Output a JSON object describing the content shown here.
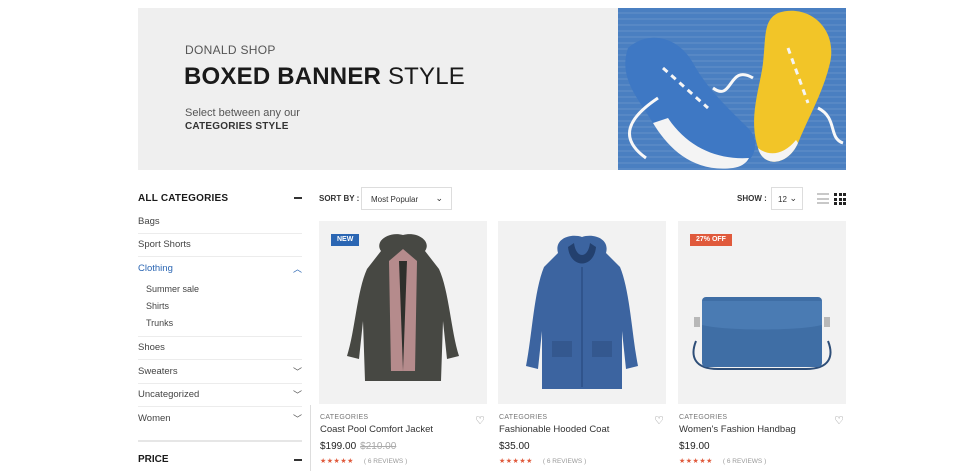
{
  "banner": {
    "kicker": "DONALD SHOP",
    "headline_bold": "BOXED BANNER",
    "headline_light": " STYLE",
    "sub_line1": "Select between any our",
    "sub_line2": "CATEGORIES STYLE"
  },
  "sidebar": {
    "categories_title": "ALL CATEGORIES",
    "categories": [
      {
        "label": "Bags"
      },
      {
        "label": "Sport Shorts"
      },
      {
        "label": "Clothing"
      },
      {
        "label": "Shoes"
      },
      {
        "label": "Sweaters"
      },
      {
        "label": "Uncategorized"
      },
      {
        "label": "Women"
      }
    ],
    "clothing_subcategories": [
      "Summer sale",
      "Shirts",
      "Trunks"
    ],
    "price_title": "PRICE"
  },
  "toolbar": {
    "sort_label": "SORT BY :",
    "sort_value": "Most Popular",
    "show_label": "SHOW :",
    "show_value": "12"
  },
  "products": [
    {
      "badge": "NEW",
      "category": "CATEGORIES",
      "name": "Coast Pool Comfort Jacket",
      "price": "$199.00",
      "old_price": "$210.00",
      "stars": "★★★★★",
      "reviews": "( 6 REVIEWS )",
      "rating": 5
    },
    {
      "badge": "",
      "category": "CATEGORIES",
      "name": "Fashionable Hooded Coat",
      "price": "$35.00",
      "old_price": "",
      "stars": "★★★★★",
      "reviews": "( 6 REVIEWS )",
      "rating": 5
    },
    {
      "badge": "27% OFF",
      "category": "CATEGORIES",
      "name": "Women's Fashion Handbag",
      "price": "$19.00",
      "old_price": "",
      "stars": "★★★★★",
      "reviews": "( 6 REVIEWS )",
      "rating": 5
    }
  ],
  "colors": {
    "accent_blue": "#2b66b3",
    "sale_red": "#e05a3c",
    "star_color": "#e05a3c"
  },
  "icons": {
    "collapse": "minus-icon",
    "expand": "chevron-down-icon",
    "collapse_up": "chevron-up-icon",
    "wishlist": "heart-icon",
    "list_view": "list-view-icon",
    "grid_view": "grid-view-icon"
  }
}
